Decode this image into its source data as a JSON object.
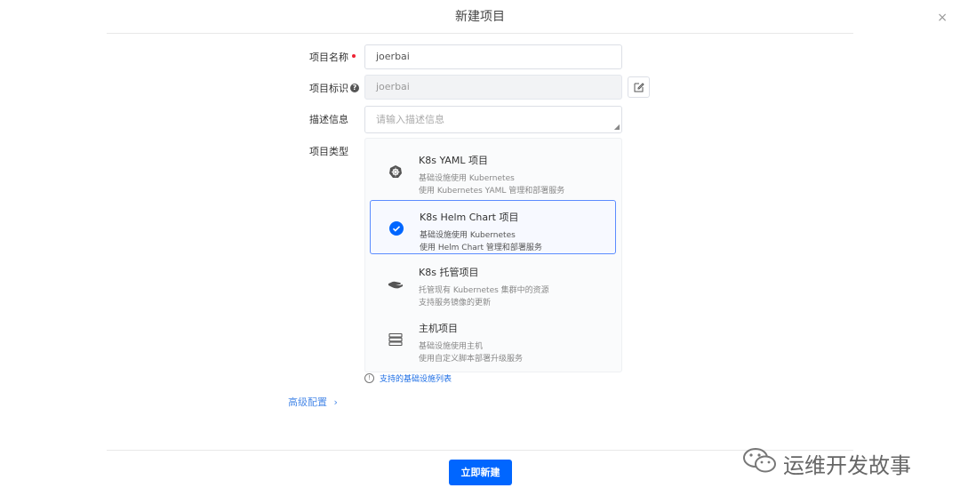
{
  "dialog": {
    "title": "新建项目",
    "close_glyph": "×",
    "submit_label": "立即新建"
  },
  "form": {
    "name_label": "项目名称",
    "name_value": "joerbai",
    "id_label": "项目标识",
    "id_value": "joerbai",
    "desc_label": "描述信息",
    "desc_placeholder": "请输入描述信息",
    "type_label": "项目类型"
  },
  "types": [
    {
      "title": "K8s YAML 项目",
      "line1": "基础设施使用 Kubernetes",
      "line2": "使用 Kubernetes YAML 管理和部署服务",
      "icon": "kubernetes-icon",
      "selected": false
    },
    {
      "title": "K8s Helm Chart 项目",
      "line1": "基础设施使用 Kubernetes",
      "line2": "使用 Helm Chart 管理和部署服务",
      "icon": "check-circle-icon",
      "selected": true
    },
    {
      "title": "K8s 托管项目",
      "line1": "托管现有 Kubernetes 集群中的资源",
      "line2": "支持服务镜像的更新",
      "icon": "hand-icon",
      "selected": false
    },
    {
      "title": "主机项目",
      "line1": "基础设施使用主机",
      "line2": "使用自定义脚本部署升级服务",
      "icon": "server-icon",
      "selected": false
    }
  ],
  "support_link": "支持的基础设施列表",
  "advanced": {
    "label": "高级配置",
    "chevron": "›"
  },
  "watermark": "运维开发故事",
  "colors": {
    "primary": "#0066ff",
    "link": "#1f6fe5",
    "required": "#ee2233"
  }
}
